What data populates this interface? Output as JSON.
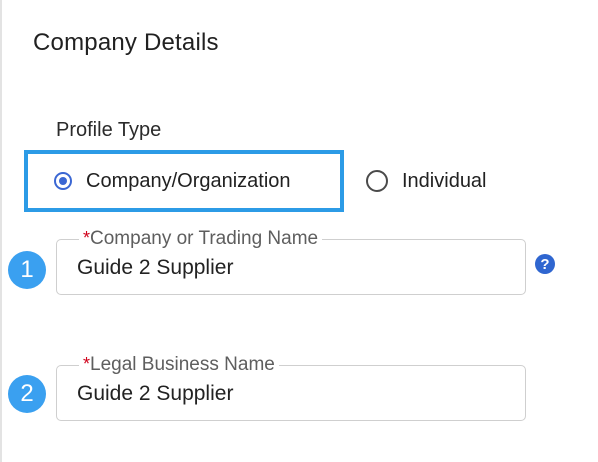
{
  "section": {
    "title": "Company Details"
  },
  "profile_type": {
    "label": "Profile Type",
    "options": [
      {
        "label": "Company/Organization",
        "selected": true
      },
      {
        "label": "Individual",
        "selected": false
      }
    ]
  },
  "steps": [
    "1",
    "2"
  ],
  "fields": [
    {
      "required_marker": "*",
      "label": "Company or Trading Name",
      "value": "Guide 2 Supplier",
      "help_icon": "question-circle-icon"
    },
    {
      "required_marker": "*",
      "label": "Legal Business Name",
      "value": "Guide 2 Supplier"
    }
  ],
  "help": {
    "glyph": "?"
  },
  "colors": {
    "highlight_border": "#2c9be6",
    "radio_accent": "#3b67d3",
    "step_badge": "#3aa0f0",
    "required": "#d0021b",
    "help_icon": "#2f66d0"
  }
}
